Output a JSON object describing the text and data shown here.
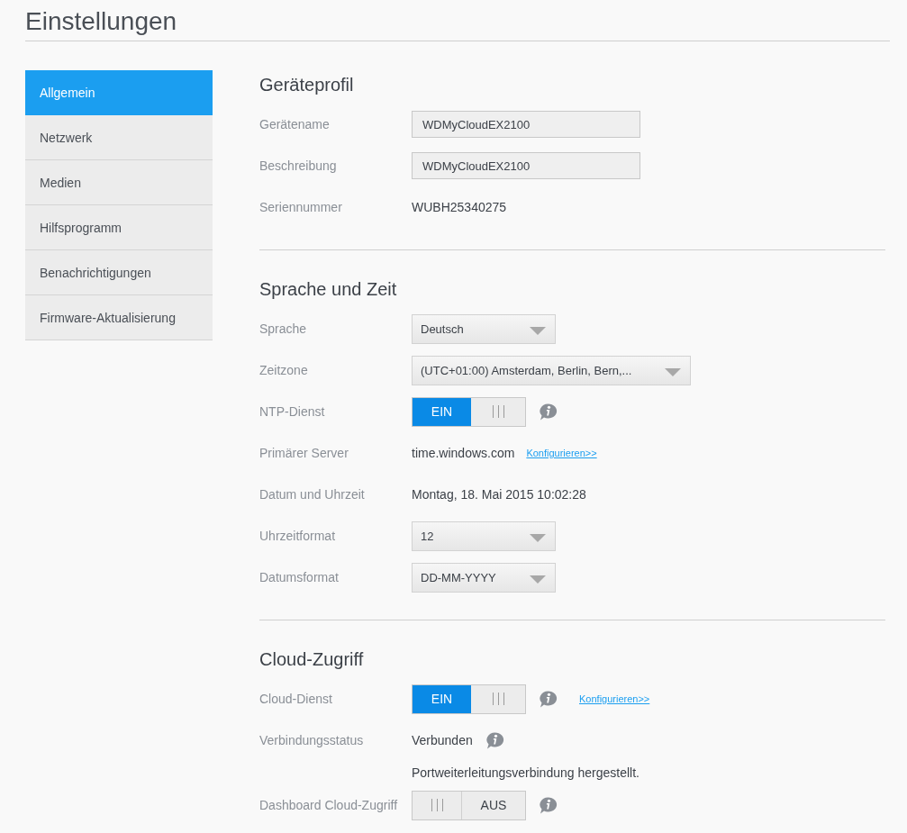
{
  "title": "Einstellungen",
  "sidebar": {
    "items": [
      {
        "label": "Allgemein",
        "selected": true
      },
      {
        "label": "Netzwerk",
        "selected": false
      },
      {
        "label": "Medien",
        "selected": false
      },
      {
        "label": "Hilfsprogramm",
        "selected": false
      },
      {
        "label": "Benachrichtigungen",
        "selected": false
      },
      {
        "label": "Firmware-Aktualisierung",
        "selected": false
      }
    ]
  },
  "sections": [
    {
      "heading": "Geräteprofil",
      "rows": [
        {
          "kind": "input",
          "label": "Gerätename",
          "value": "WDMyCloudEX2100"
        },
        {
          "kind": "input",
          "label": "Beschreibung",
          "value": "WDMyCloudEX2100"
        },
        {
          "kind": "text",
          "label": "Seriennummer",
          "value": "WUBH25340275"
        }
      ]
    },
    {
      "heading": "Sprache und Zeit",
      "rows": [
        {
          "kind": "select",
          "label": "Sprache",
          "value": "Deutsch",
          "wide": false
        },
        {
          "kind": "select",
          "label": "Zeitzone",
          "value": "(UTC+01:00) Amsterdam, Berlin, Bern,...",
          "wide": true
        },
        {
          "kind": "toggle",
          "label": "NTP-Dienst",
          "on": true,
          "state_label": "EIN",
          "info": true
        },
        {
          "kind": "text",
          "label": "Primärer Server",
          "value": "time.windows.com",
          "link": "Konfigurieren>>"
        },
        {
          "kind": "text",
          "label": "Datum und Uhrzeit",
          "value": "Montag, 18. Mai 2015 10:02:28"
        },
        {
          "kind": "select",
          "label": "Uhrzeitformat",
          "value": "12",
          "wide": false
        },
        {
          "kind": "select",
          "label": "Datumsformat",
          "value": "DD-MM-YYYY",
          "wide": false
        }
      ]
    },
    {
      "heading": "Cloud-Zugriff",
      "rows": [
        {
          "kind": "toggle",
          "label": "Cloud-Dienst",
          "on": true,
          "state_label": "EIN",
          "info": true,
          "link": "Konfigurieren>>"
        },
        {
          "kind": "text",
          "label": "Verbindungsstatus",
          "value": "Verbunden",
          "info": true
        },
        {
          "kind": "note",
          "value": "Portweiterleitungsverbindung hergestellt."
        },
        {
          "kind": "toggle",
          "label": "Dashboard Cloud-Zugriff",
          "on": false,
          "state_label": "AUS",
          "info": true
        }
      ]
    }
  ]
}
